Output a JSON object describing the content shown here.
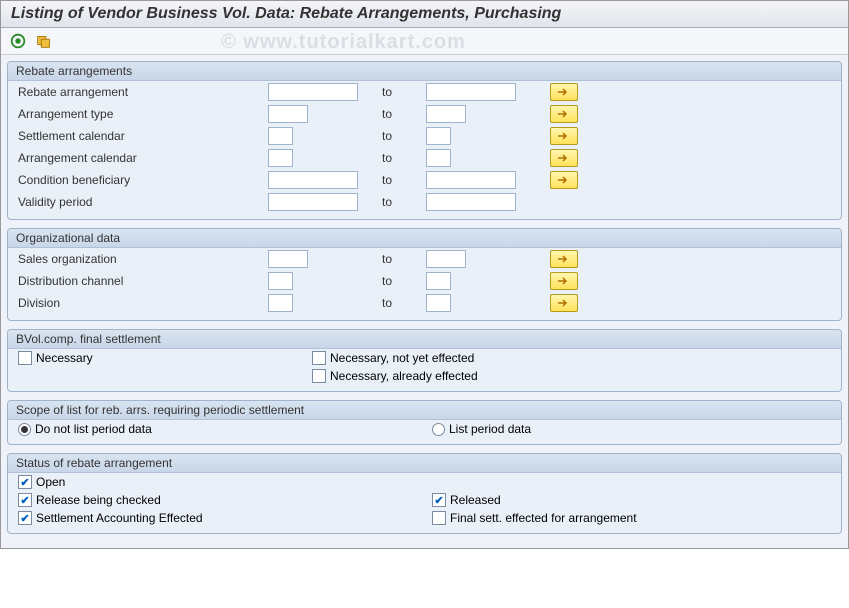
{
  "title": "Listing of Vendor Business Vol. Data: Rebate Arrangements, Purchasing",
  "watermark": "© www.tutorialkart.com",
  "groups": {
    "rebate": {
      "title": "Rebate arrangements",
      "fields": {
        "rebate_arrangement": "Rebate arrangement",
        "arrangement_type": "Arrangement type",
        "settlement_calendar": "Settlement calendar",
        "arrangement_calendar": "Arrangement calendar",
        "condition_beneficiary": "Condition beneficiary",
        "validity_period": "Validity period"
      },
      "to": "to"
    },
    "org": {
      "title": "Organizational data",
      "fields": {
        "sales_org": "Sales organization",
        "dist_channel": "Distribution channel",
        "division": "Division"
      },
      "to": "to"
    },
    "bvol": {
      "title": "BVol.comp. final settlement",
      "necessary": "Necessary",
      "necessary_not_yet": "Necessary, not yet effected",
      "necessary_already": "Necessary, already effected"
    },
    "scope": {
      "title": "Scope of list for reb. arrs. requiring periodic settlement",
      "do_not_list": "Do not list period data",
      "list": "List period data"
    },
    "status": {
      "title": "Status of rebate arrangement",
      "open": "Open",
      "release_checked": "Release being checked",
      "released": "Released",
      "settlement_acc": "Settlement Accounting Effected",
      "final_sett": "Final sett. effected for arrangement"
    }
  },
  "icons": {
    "execute": "execute-icon",
    "variant": "variant-icon",
    "arrow": "⇨"
  }
}
